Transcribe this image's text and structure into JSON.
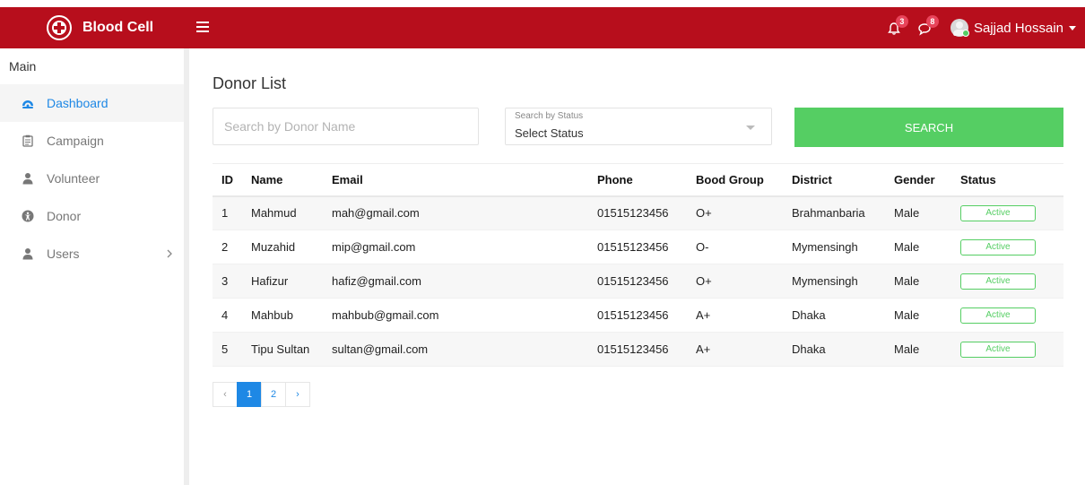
{
  "header": {
    "brand": "Blood Cell",
    "notifications_count": "3",
    "messages_count": "8",
    "user_name": "Sajjad Hossain"
  },
  "sidebar": {
    "heading": "Main",
    "items": [
      {
        "label": "Dashboard",
        "icon": "dashboard-icon"
      },
      {
        "label": "Campaign",
        "icon": "clipboard-icon"
      },
      {
        "label": "Volunteer",
        "icon": "user-icon"
      },
      {
        "label": "Donor",
        "icon": "accessibility-icon"
      },
      {
        "label": "Users",
        "icon": "user-icon"
      }
    ]
  },
  "main": {
    "title": "Donor List",
    "search_placeholder": "Search by Donor Name",
    "status_filter_label": "Search by Status",
    "status_filter_value": "Select Status",
    "search_button": "SEARCH",
    "table": {
      "headers": [
        "ID",
        "Name",
        "Email",
        "Phone",
        "Bood Group",
        "District",
        "Gender",
        "Status"
      ],
      "rows": [
        [
          "1",
          "Mahmud",
          "mah@gmail.com",
          "01515123456",
          "O+",
          "Brahmanbaria",
          "Male",
          "Active"
        ],
        [
          "2",
          "Muzahid",
          "mip@gmail.com",
          "01515123456",
          "O-",
          "Mymensingh",
          "Male",
          "Active"
        ],
        [
          "3",
          "Hafizur",
          "hafiz@gmail.com",
          "01515123456",
          "O+",
          "Mymensingh",
          "Male",
          "Active"
        ],
        [
          "4",
          "Mahbub",
          "mahbub@gmail.com",
          "01515123456",
          "A+",
          "Dhaka",
          "Male",
          "Active"
        ],
        [
          "5",
          "Tipu Sultan",
          "sultan@gmail.com",
          "01515123456",
          "A+",
          "Dhaka",
          "Male",
          "Active"
        ]
      ]
    },
    "pagination": {
      "prev": "‹",
      "pages": [
        "1",
        "2"
      ],
      "next": "›"
    }
  },
  "colors": {
    "header_bg": "#b70e1c",
    "accent_blue": "#1e88e5",
    "success_green": "#55ce63",
    "badge_red": "#e8445a"
  }
}
